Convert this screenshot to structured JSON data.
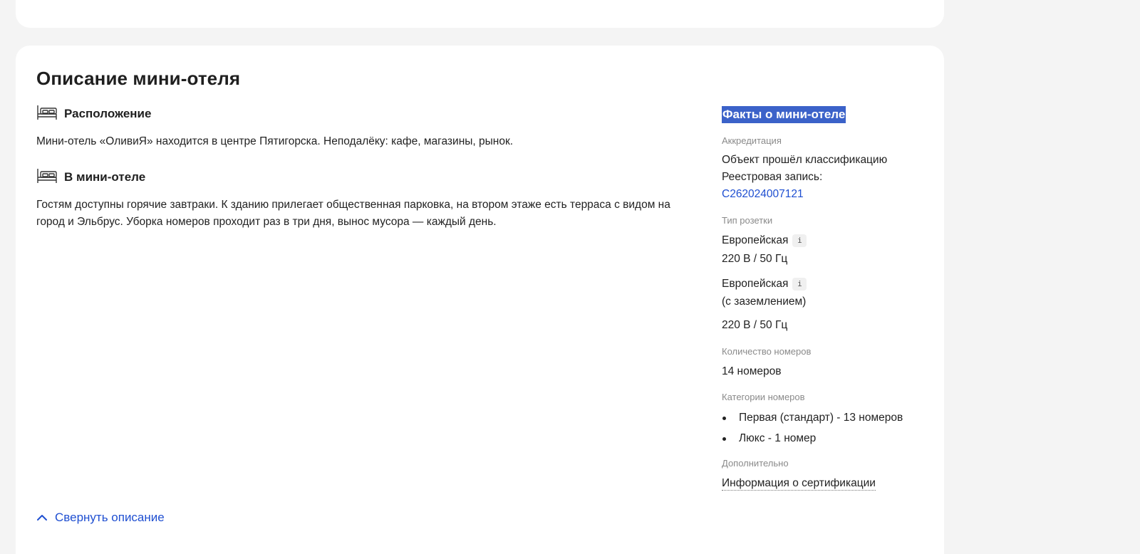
{
  "title": "Описание мини-отеля",
  "sections": [
    {
      "icon": "bed-icon",
      "heading": "Расположение",
      "text": "Мини-отель «ОливиЯ» находится в центре Пятигорска. Неподалёку: кафе, магазины, рынок."
    },
    {
      "icon": "bed-icon",
      "heading": "В мини-отеле",
      "text": "Гостям доступны горячие завтраки. К зданию прилегает общественная парковка, на втором этаже есть терраса с видом на город и Эльбрус. Уборка номеров проходит раз в три дня, вынос мусора — каждый день."
    }
  ],
  "facts": {
    "title": "Факты о мини-отеле",
    "accreditation": {
      "label": "Аккредитация",
      "line1": "Объект прошёл классификацию",
      "line2": "Реестровая запись:",
      "registry_id": "C262024007121"
    },
    "socket": {
      "label": "Тип розетки",
      "items": [
        {
          "name": "Европейская",
          "extra": "",
          "spec": "220 В / 50 Гц"
        },
        {
          "name": "Европейская",
          "extra": "(с заземлением)",
          "spec": "220 В / 50 Гц"
        }
      ],
      "info_glyph": "i"
    },
    "rooms_count": {
      "label": "Количество номеров",
      "value": "14 номеров"
    },
    "room_categories": {
      "label": "Категории номеров",
      "items": [
        "Первая (стандарт) - 13 номеров",
        "Люкс - 1 номер"
      ]
    },
    "additional": {
      "label": "Дополнительно",
      "link": "Информация о сертификации"
    }
  },
  "collapse_label": "Свернуть описание",
  "colors": {
    "accent": "#1f4fd1",
    "selection": "#3b62c9",
    "background": "#f4f4f4"
  }
}
